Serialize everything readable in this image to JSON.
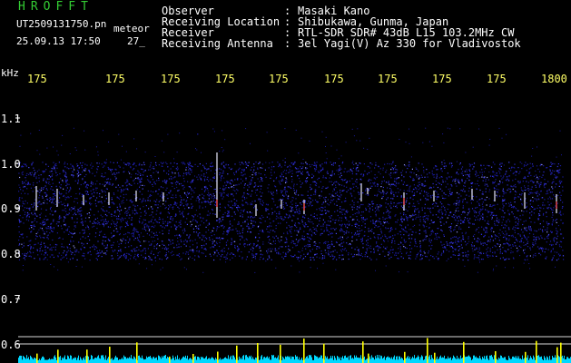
{
  "header": {
    "logo": "HROFFT",
    "file_name": "UT2509131750.pn",
    "mode": "meteor",
    "date_time": "25.09.13 17:50",
    "frame_count": "27_"
  },
  "info": [
    {
      "key": "Observer",
      "value": "Masaki Kano"
    },
    {
      "key": "Receiving Location",
      "value": "Shibukawa, Gunma, Japan"
    },
    {
      "key": "Receiver",
      "value": "RTL-SDR SDR# 43dB L15 103.2MHz CW"
    },
    {
      "key": "Receiving Antenna",
      "value": "3el Yagi(V) Az 330 for Vladivostok"
    }
  ],
  "colon": ":",
  "axes": {
    "y_unit": "kHz",
    "x_ticks": [
      "175",
      "175",
      "175",
      "175",
      "175",
      "175",
      "175",
      "175",
      "175",
      "1800"
    ],
    "y_ticks": [
      "1.1",
      "1.0",
      "0.9",
      "0.8",
      "0.7",
      "0.6"
    ]
  },
  "colors": {
    "header_green": "#33cc33",
    "label_white": "#ffffff",
    "tick_yellow": "#ffff66",
    "background": "#000000",
    "noise_blue": "#1a1aa0",
    "echo_white": "#e8e8ff",
    "bottom_cyan": "#00d8ff",
    "bottom_yellow": "#ffff00"
  }
}
